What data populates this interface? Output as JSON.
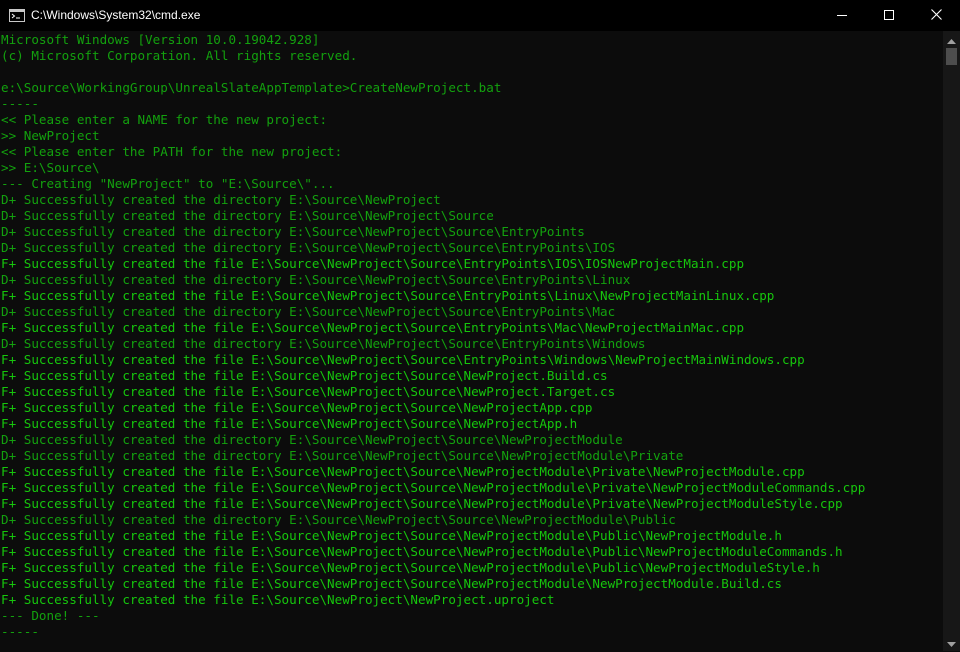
{
  "window": {
    "title": "C:\\Windows\\System32\\cmd.exe",
    "icon": "cmd-icon",
    "controls": [
      "minimize-icon",
      "maximize-icon",
      "close-icon"
    ]
  },
  "colors": {
    "background": "#0c0c0c",
    "default_text": "#cccccc",
    "green_text": "#13a10e",
    "bright_green_text": "#16c60c",
    "titlebar": "#000000"
  },
  "console": {
    "lines": [
      {
        "text": "Microsoft Windows [Version 10.0.19042.928]",
        "style": "green"
      },
      {
        "text": "(c) Microsoft Corporation. All rights reserved.",
        "style": "green"
      },
      {
        "text": "",
        "style": "green"
      },
      {
        "text": "e:\\Source\\WorkingGroup\\UnrealSlateAppTemplate>CreateNewProject.bat",
        "style": "green"
      },
      {
        "text": "-----",
        "style": "green"
      },
      {
        "text": "<< Please enter a NAME for the new project:",
        "style": "green"
      },
      {
        "text": ">> NewProject",
        "style": "green"
      },
      {
        "text": "<< Please enter the PATH for the new project:",
        "style": "green"
      },
      {
        "text": ">> E:\\Source\\",
        "style": "green"
      },
      {
        "text": "--- Creating \"NewProject\" to \"E:\\Source\\\"...",
        "style": "green"
      },
      {
        "text": "D+ Successfully created the directory E:\\Source\\NewProject",
        "style": "green"
      },
      {
        "text": "D+ Successfully created the directory E:\\Source\\NewProject\\Source",
        "style": "green"
      },
      {
        "text": "D+ Successfully created the directory E:\\Source\\NewProject\\Source\\EntryPoints",
        "style": "green"
      },
      {
        "text": "D+ Successfully created the directory E:\\Source\\NewProject\\Source\\EntryPoints\\IOS",
        "style": "green"
      },
      {
        "text": "F+ Successfully created the file E:\\Source\\NewProject\\Source\\EntryPoints\\IOS\\IOSNewProjectMain.cpp",
        "style": "bright"
      },
      {
        "text": "D+ Successfully created the directory E:\\Source\\NewProject\\Source\\EntryPoints\\Linux",
        "style": "green"
      },
      {
        "text": "F+ Successfully created the file E:\\Source\\NewProject\\Source\\EntryPoints\\Linux\\NewProjectMainLinux.cpp",
        "style": "bright"
      },
      {
        "text": "D+ Successfully created the directory E:\\Source\\NewProject\\Source\\EntryPoints\\Mac",
        "style": "green"
      },
      {
        "text": "F+ Successfully created the file E:\\Source\\NewProject\\Source\\EntryPoints\\Mac\\NewProjectMainMac.cpp",
        "style": "bright"
      },
      {
        "text": "D+ Successfully created the directory E:\\Source\\NewProject\\Source\\EntryPoints\\Windows",
        "style": "green"
      },
      {
        "text": "F+ Successfully created the file E:\\Source\\NewProject\\Source\\EntryPoints\\Windows\\NewProjectMainWindows.cpp",
        "style": "bright"
      },
      {
        "text": "F+ Successfully created the file E:\\Source\\NewProject\\Source\\NewProject.Build.cs",
        "style": "bright"
      },
      {
        "text": "F+ Successfully created the file E:\\Source\\NewProject\\Source\\NewProject.Target.cs",
        "style": "bright"
      },
      {
        "text": "F+ Successfully created the file E:\\Source\\NewProject\\Source\\NewProjectApp.cpp",
        "style": "bright"
      },
      {
        "text": "F+ Successfully created the file E:\\Source\\NewProject\\Source\\NewProjectApp.h",
        "style": "bright"
      },
      {
        "text": "D+ Successfully created the directory E:\\Source\\NewProject\\Source\\NewProjectModule",
        "style": "green"
      },
      {
        "text": "D+ Successfully created the directory E:\\Source\\NewProject\\Source\\NewProjectModule\\Private",
        "style": "green"
      },
      {
        "text": "F+ Successfully created the file E:\\Source\\NewProject\\Source\\NewProjectModule\\Private\\NewProjectModule.cpp",
        "style": "bright"
      },
      {
        "text": "F+ Successfully created the file E:\\Source\\NewProject\\Source\\NewProjectModule\\Private\\NewProjectModuleCommands.cpp",
        "style": "bright"
      },
      {
        "text": "F+ Successfully created the file E:\\Source\\NewProject\\Source\\NewProjectModule\\Private\\NewProjectModuleStyle.cpp",
        "style": "bright"
      },
      {
        "text": "D+ Successfully created the directory E:\\Source\\NewProject\\Source\\NewProjectModule\\Public",
        "style": "green"
      },
      {
        "text": "F+ Successfully created the file E:\\Source\\NewProject\\Source\\NewProjectModule\\Public\\NewProjectModule.h",
        "style": "bright"
      },
      {
        "text": "F+ Successfully created the file E:\\Source\\NewProject\\Source\\NewProjectModule\\Public\\NewProjectModuleCommands.h",
        "style": "bright"
      },
      {
        "text": "F+ Successfully created the file E:\\Source\\NewProject\\Source\\NewProjectModule\\Public\\NewProjectModuleStyle.h",
        "style": "bright"
      },
      {
        "text": "F+ Successfully created the file E:\\Source\\NewProject\\Source\\NewProjectModule\\NewProjectModule.Build.cs",
        "style": "bright"
      },
      {
        "text": "F+ Successfully created the file E:\\Source\\NewProject\\NewProject.uproject",
        "style": "bright"
      },
      {
        "text": "--- Done! ---",
        "style": "green"
      },
      {
        "text": "-----",
        "style": "green"
      }
    ]
  }
}
